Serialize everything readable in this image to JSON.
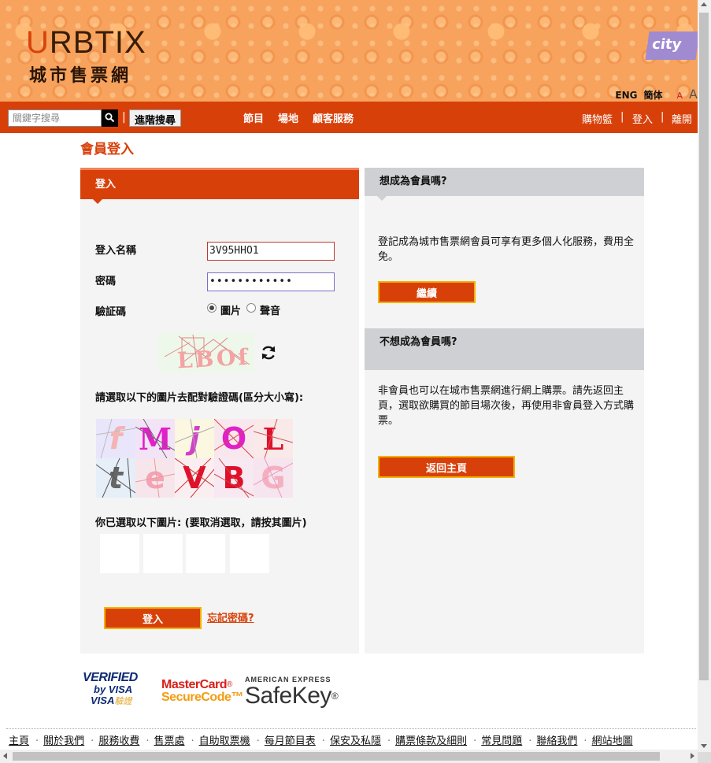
{
  "header": {
    "logo_en_first": "U",
    "logo_en_rest": "RBTIX",
    "logo_zh": "城市售票網",
    "partner_logo": "city",
    "lang_eng": "ENG",
    "lang_sc": "簡体",
    "font_small": "A",
    "font_large": "A"
  },
  "nav": {
    "search_placeholder": "關鍵字搜尋",
    "separator": "|",
    "advanced_search": "進階搜尋",
    "links": [
      "節目",
      "場地",
      "顧客服務"
    ],
    "right": {
      "cart": "購物籃",
      "login": "登入",
      "logout": "離開",
      "sep": "|"
    }
  },
  "page_title": "會員登入",
  "login": {
    "heading": "登入",
    "username_label": "登入名稱",
    "username_value": "3V95HHO1",
    "password_label": "密碼",
    "password_mask": "••••••••••••",
    "captcha_label": "驗証碼",
    "captcha_mode_image": "圖片",
    "captcha_mode_audio": "聲音",
    "captcha_mode_selected": "圖片",
    "captcha_text": "LBOf",
    "choose_instruction": "請選取以下的圖片去配對驗證碼(區分大小寫):",
    "tiles": [
      "f",
      "M",
      "j",
      "O",
      "L",
      "t",
      "e",
      "V",
      "B",
      "G"
    ],
    "selected_instruction": "你已選取以下圖片: (要取消選取，請按其圖片)",
    "login_button": "登入",
    "forgot_link": "忘記密碼?"
  },
  "member_panel": {
    "heading": "想成為會員嗎?",
    "text": "登記成為城市售票網會員可享有更多個人化服務，費用全免。",
    "button": "繼續"
  },
  "guest_panel": {
    "heading": "不想成為會員嗎?",
    "text": "非會員也可以在城市售票網進行網上購票。請先返回主頁，選取欲購買的節目場次後，再使用非會員登入方式購票。",
    "button": "返回主頁"
  },
  "payment": {
    "visa_line1": "VERIFIED",
    "visa_line2": "by VISA",
    "visa_line3": "VISA",
    "visa_line3_zh": "驗證",
    "mc_line1": "MasterCard",
    "mc_reg": "®",
    "mc_line2": "SecureCode",
    "mc_tm": "™",
    "amex_line1": "AMERICAN EXPRESS",
    "amex_line2": "SafeKey",
    "amex_reg": "®"
  },
  "footer_links": [
    "主頁",
    "關於我們",
    "服務收費",
    "售票處",
    "自助取票機",
    "每月節目表",
    "保安及私隱",
    "購票條款及細則",
    "常見問題",
    "聯絡我們",
    "網站地圖"
  ],
  "footer_separator": "·",
  "colors": {
    "brand_orange": "#d8400a",
    "button_border": "#f3b200",
    "panel_bg": "#f4f4f4",
    "side_head_bg": "#cfd0d3"
  }
}
